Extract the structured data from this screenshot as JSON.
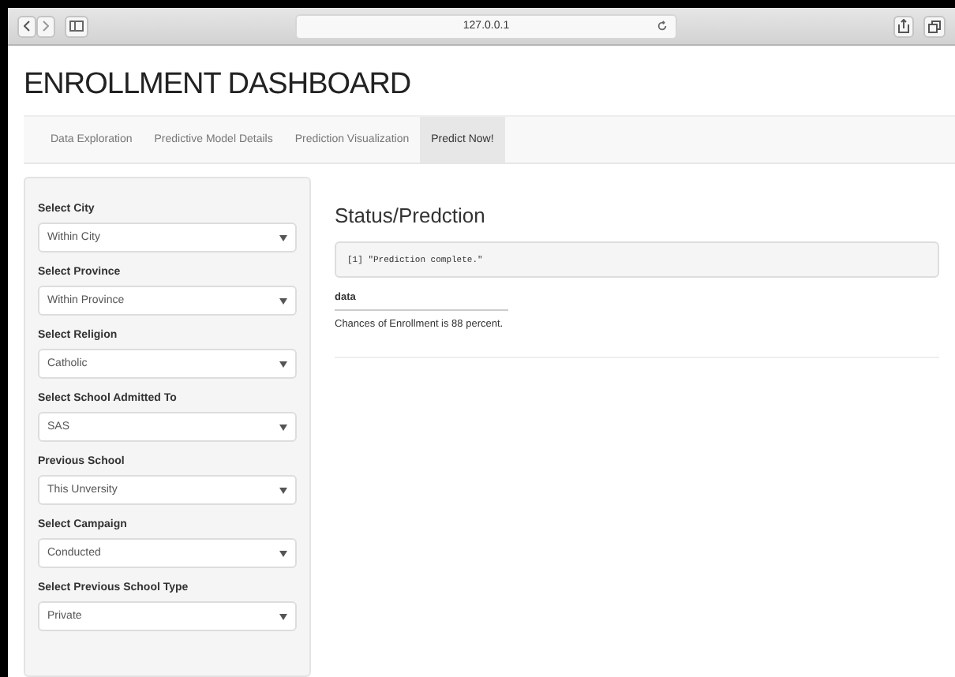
{
  "browser": {
    "address": "127.0.0.1"
  },
  "title": "ENROLLMENT DASHBOARD",
  "tabs": [
    {
      "label": "Data Exploration",
      "selected": false
    },
    {
      "label": "Predictive Model Details",
      "selected": false
    },
    {
      "label": "Prediction Visualization",
      "selected": false
    },
    {
      "label": "Predict Now!",
      "selected": true
    }
  ],
  "filters": [
    {
      "label": "Select City",
      "value": "Within City"
    },
    {
      "label": "Select Province",
      "value": "Within Province"
    },
    {
      "label": "Select Religion",
      "value": "Catholic"
    },
    {
      "label": "Select School Admitted To",
      "value": "SAS"
    },
    {
      "label": "Previous School",
      "value": "This Unversity"
    },
    {
      "label": "Select Campaign",
      "value": "Conducted"
    },
    {
      "label": "Select Previous School Type",
      "value": "Private"
    }
  ],
  "status": {
    "heading": "Status/Predction",
    "output": "[1] \"Prediction complete.\"",
    "table_header": "data",
    "table_cell": "Chances of Enrollment is 88 percent."
  }
}
